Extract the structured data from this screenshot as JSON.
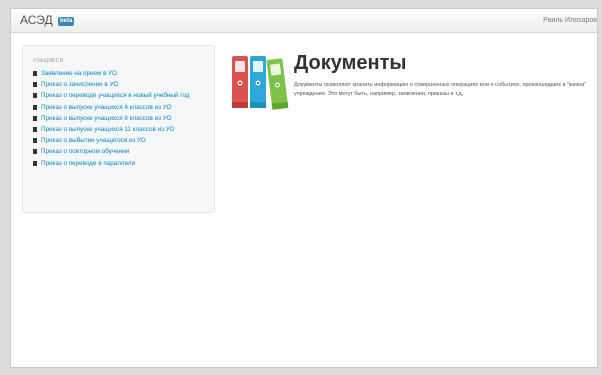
{
  "header": {
    "brand": "АСЭД",
    "beta": "beta",
    "user": "Раиль Илоsaров"
  },
  "sidebar": {
    "heading": "УЧАЩИЕСЯ",
    "items": [
      {
        "label": "Заявление на прием в УО"
      },
      {
        "label": "Приказ о зачислении в УО"
      },
      {
        "label": "Приказ о переводе учащихся в новый учебный год"
      },
      {
        "label": "Приказ о выпуске учащихся 4 классов из УО"
      },
      {
        "label": "Приказ о выпуске учащихся 9 классов из УО"
      },
      {
        "label": "Приказ о выпуске учащихся 11 классов из УО"
      },
      {
        "label": "Приказ о выбытии учащегося из УО"
      },
      {
        "label": "Приказ о повторном обучении"
      },
      {
        "label": "Приказ о переводе в параллели"
      }
    ]
  },
  "hero": {
    "title": "Документы",
    "description": "Документы позволяют хранить информацию о совершенных операциях или о событиях, произошедших в \"жизни\" учреждения. Это могут быть, например, заявления, приказы и т.д."
  },
  "colors": {
    "link": "#0088cc",
    "beta_badge": "#3a87ad",
    "binder_red": "#d9534f",
    "binder_blue": "#2ea8d8",
    "binder_green": "#7fc24a"
  },
  "icons": {
    "nav_item": "document-icon",
    "hero": "binders-icon"
  }
}
